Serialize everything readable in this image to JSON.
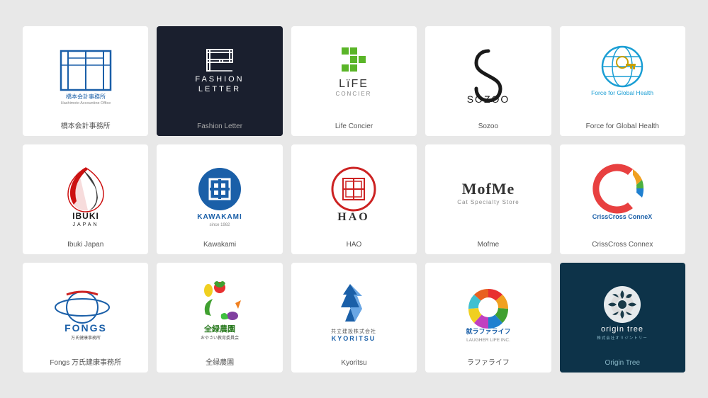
{
  "logos": [
    {
      "id": "hashimoto",
      "label": "橋本会計事務所",
      "bg": "white",
      "type": "hashimoto"
    },
    {
      "id": "fashion-letter",
      "label": "Fashion Letter",
      "bg": "dark",
      "type": "fashion-letter"
    },
    {
      "id": "life-concier",
      "label": "Life Concier",
      "bg": "white",
      "type": "life-concier"
    },
    {
      "id": "sozoo",
      "label": "Sozoo",
      "bg": "white",
      "type": "sozoo"
    },
    {
      "id": "force-global-health",
      "label": "Force for Global Health",
      "bg": "white",
      "type": "force-global-health"
    },
    {
      "id": "ibuki-japan",
      "label": "Ibuki Japan",
      "bg": "white",
      "type": "ibuki-japan"
    },
    {
      "id": "kawakami",
      "label": "Kawakami",
      "bg": "white",
      "type": "kawakami"
    },
    {
      "id": "hao",
      "label": "HAO",
      "bg": "white",
      "type": "hao"
    },
    {
      "id": "mofme",
      "label": "Mofme",
      "bg": "white",
      "type": "mofme"
    },
    {
      "id": "crisscross-connex",
      "label": "CrissCross Connex",
      "bg": "white",
      "type": "crisscross-connex"
    },
    {
      "id": "fongs",
      "label": "Fongs 万氏建康事務所",
      "bg": "white",
      "type": "fongs"
    },
    {
      "id": "zenroku",
      "label": "全緑農園",
      "bg": "white",
      "type": "zenroku"
    },
    {
      "id": "kyoritsu",
      "label": "Kyoritsu",
      "bg": "white",
      "type": "kyoritsu"
    },
    {
      "id": "laugher-life",
      "label": "ラファライフ",
      "bg": "white",
      "type": "laugher-life"
    },
    {
      "id": "origin-tree",
      "label": "Origin Tree",
      "bg": "teal",
      "type": "origin-tree"
    }
  ]
}
